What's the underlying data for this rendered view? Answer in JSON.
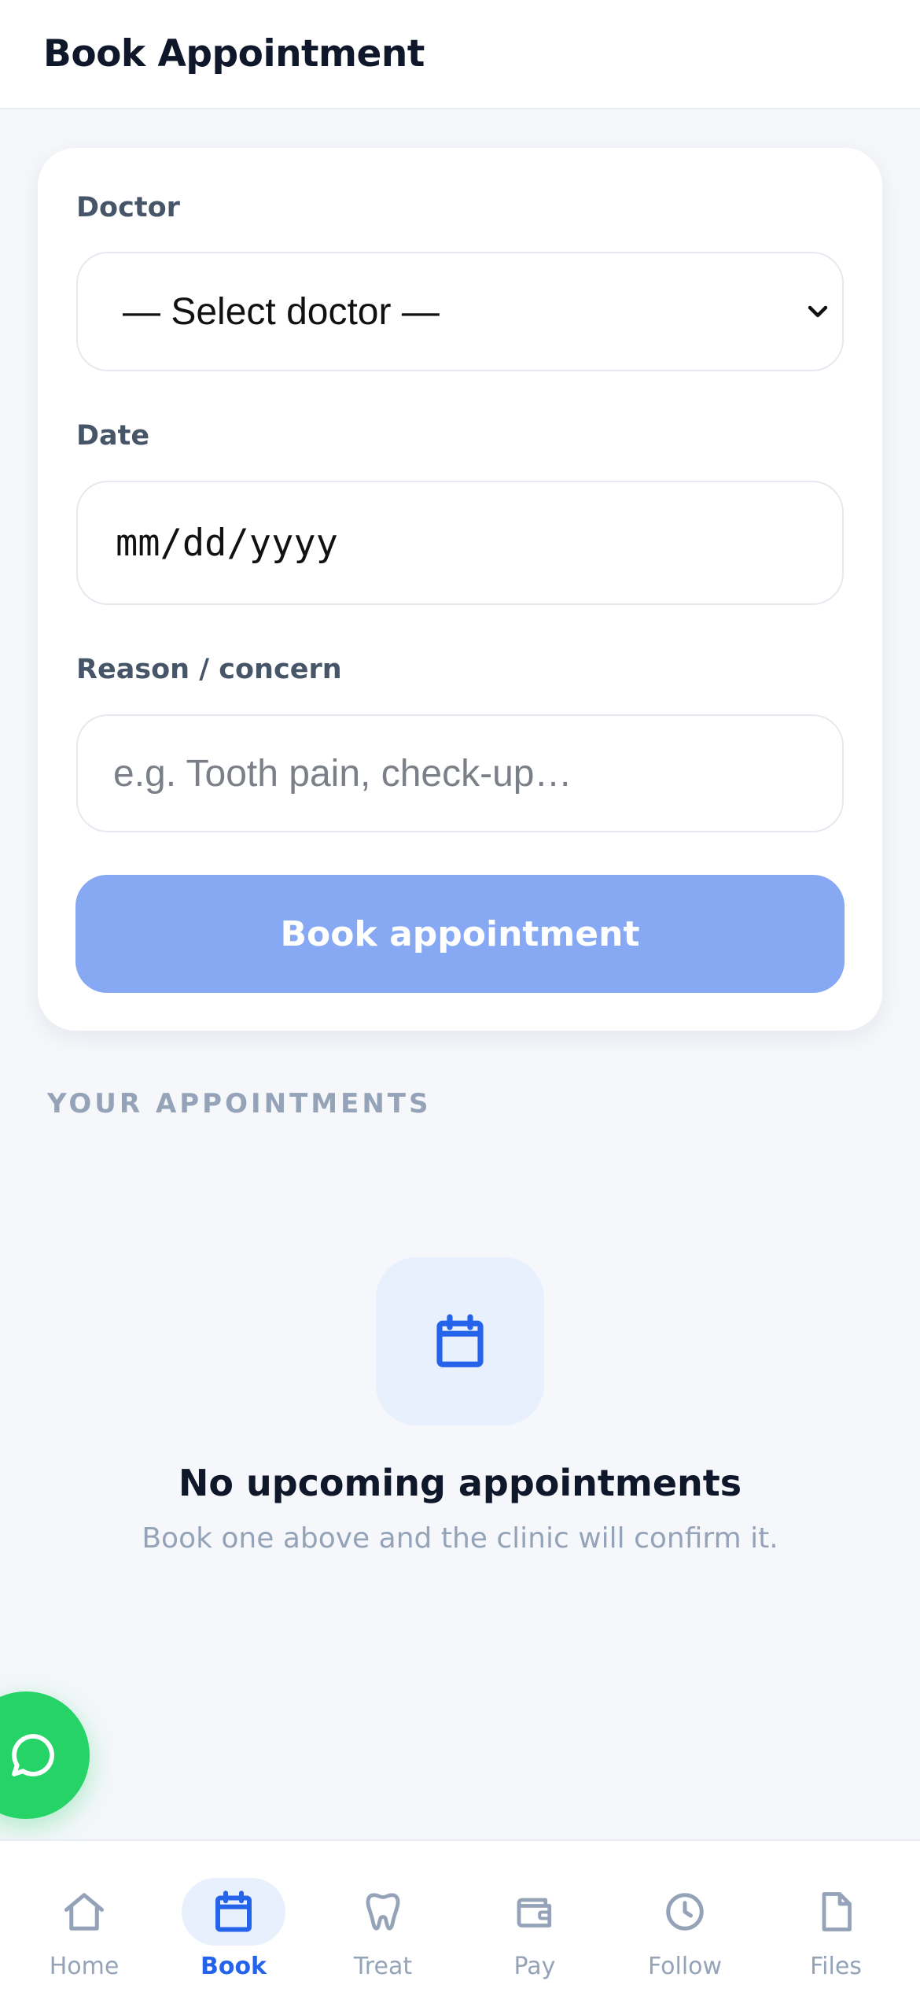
{
  "header": {
    "title": "Book Appointment"
  },
  "form": {
    "doctor_label": "Doctor",
    "doctor_selected": "— Select doctor —",
    "date_label": "Date",
    "date_value": "mm/dd/yyyy",
    "reason_label": "Reason / concern",
    "reason_placeholder": "e.g. Tooth pain, check-up…",
    "submit_label": "Book appointment"
  },
  "appointments": {
    "section_title": "YOUR APPOINTMENTS",
    "empty_icon": "calendar-icon",
    "empty_title": "No upcoming appointments",
    "empty_subtitle": "Book one above and the clinic will confirm it."
  },
  "chat": {
    "icon": "chat-bubble-icon"
  },
  "nav": {
    "items": [
      {
        "label": "Home",
        "icon": "home-icon",
        "active": false
      },
      {
        "label": "Book",
        "icon": "calendar-icon",
        "active": true
      },
      {
        "label": "Treat",
        "icon": "tooth-icon",
        "active": false
      },
      {
        "label": "Pay",
        "icon": "wallet-icon",
        "active": false
      },
      {
        "label": "Follow",
        "icon": "clock-icon",
        "active": false
      },
      {
        "label": "Files",
        "icon": "file-icon",
        "active": false
      }
    ]
  },
  "colors": {
    "accent": "#2563eb",
    "button_disabled": "#87a8f2",
    "chat_green": "#25d366",
    "muted": "#94a3b8",
    "heading": "#0f172a",
    "background": "#f5f7fb"
  }
}
